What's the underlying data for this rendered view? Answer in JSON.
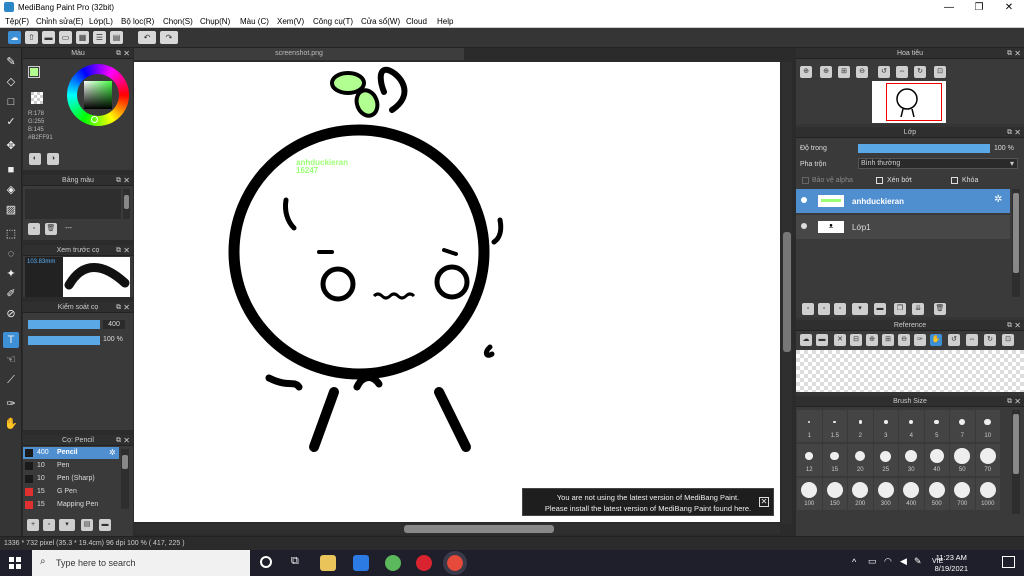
{
  "window": {
    "title": "MediBang Paint Pro (32bit)",
    "minimize": "—",
    "maximize": "❐",
    "close": "✕"
  },
  "menu": [
    "Tệp(F)",
    "Chỉnh sửa(E)",
    "Lớp(L)",
    "Bộ lọc(R)",
    "Chọn(S)",
    "Chụp(N)",
    "Màu (C)",
    "Xem(V)",
    "Công cụ(T)",
    "Cửa sổ(W)",
    "Cloud",
    "Help"
  ],
  "color_panel": {
    "title": "Màu",
    "r": "R:178",
    "g": "G:255",
    "b": "B:145",
    "hex": "#B2FF91",
    "fg_color": "#B2FF91"
  },
  "palette_panel": {
    "title": "Bảng màu",
    "item_label": "---"
  },
  "brush_preview_panel": {
    "title": "Xem trước cọ",
    "size": "103.83mm"
  },
  "brush_control_panel": {
    "title": "Kiểm soát cọ",
    "size_value": "400",
    "opacity_value": "100 %"
  },
  "brush_list_panel": {
    "title": "Cọ: Pencil",
    "items": [
      {
        "size": "400",
        "name": "Pencil",
        "color": "#1a1a1a",
        "selected": true
      },
      {
        "size": "10",
        "name": "Pen",
        "color": "#1a1a1a",
        "selected": false
      },
      {
        "size": "10",
        "name": "Pen (Sharp)",
        "color": "#1a1a1a",
        "selected": false
      },
      {
        "size": "15",
        "name": "G Pen",
        "color": "#e03030",
        "selected": false
      },
      {
        "size": "15",
        "name": "Mapping Pen",
        "color": "#e03030",
        "selected": false
      }
    ]
  },
  "canvas": {
    "tab_title": "screenshot.png",
    "text_line1": "anhduckieran",
    "text_line2": "16247"
  },
  "notice": {
    "line1": "You are not using the latest version of MediBang Paint.",
    "line2": "Please install the latest version of MediBang Paint found here.",
    "close": "✕"
  },
  "status": {
    "text": "1336 * 732 pixel   (35.3 * 19.4cm)   96 dpi   100 %   ( 417, 225 )"
  },
  "navigator_panel": {
    "title": "Hoa tiêu"
  },
  "layer_panel": {
    "title": "Lớp",
    "opacity_label": "Độ trong",
    "opacity_value": "100 %",
    "blend_label": "Pha trộn",
    "blend_value": "Bình thường",
    "protect_alpha": "Bảo vệ alpha",
    "clipping": "Xén bớt",
    "lock": "Khóa",
    "layers": [
      {
        "name": "anhduckieran",
        "selected": true
      },
      {
        "name": "Lớp1",
        "selected": false
      }
    ]
  },
  "reference_panel": {
    "title": "Reference"
  },
  "brush_size_panel": {
    "title": "Brush Size",
    "sizes": [
      "1",
      "1.5",
      "2",
      "3",
      "4",
      "5",
      "7",
      "10",
      "12",
      "15",
      "20",
      "25",
      "30",
      "40",
      "50",
      "70",
      "100",
      "150",
      "200",
      "300",
      "400",
      "500",
      "700",
      "1000"
    ]
  },
  "taskbar": {
    "search_placeholder": "Type here to search",
    "time": "11:23 AM",
    "date": "8/19/2021",
    "lang": "VIE"
  },
  "colors": {
    "accent": "#3d8fd6",
    "sprout": "#b2ff91"
  }
}
